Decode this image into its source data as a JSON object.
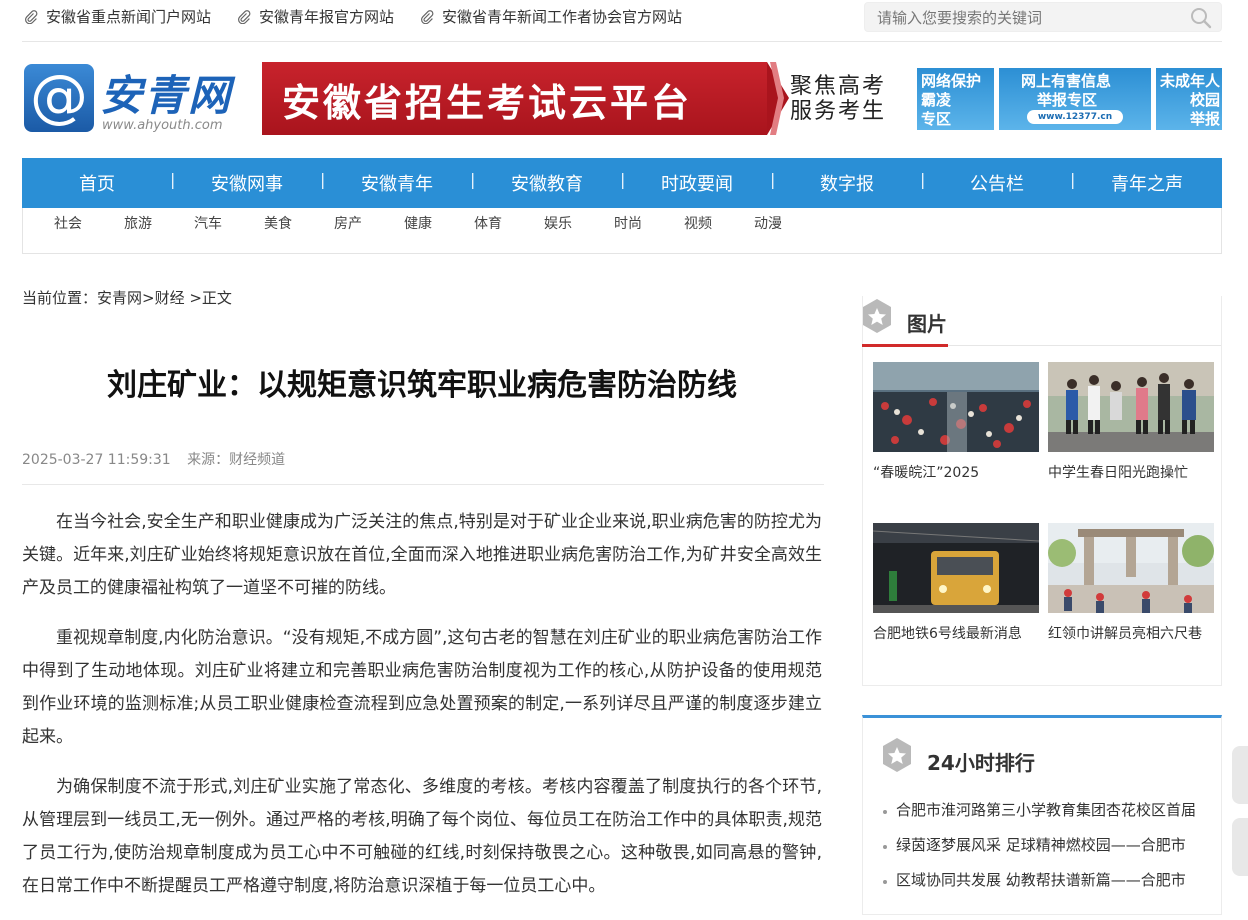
{
  "top_links": [
    {
      "label": "安徽省重点新闻门户网站",
      "icon": "paperclip-icon"
    },
    {
      "label": "安徽青年报官方网站",
      "icon": "paperclip-icon"
    },
    {
      "label": "安徽省青年新闻工作者协会官方网站",
      "icon": "paperclip-icon"
    }
  ],
  "search": {
    "placeholder": "请输入您要搜索的关键词",
    "icon": "search-icon"
  },
  "logo": {
    "symbol": "@",
    "name": "安青网",
    "url": "www.ahyouth.com"
  },
  "banner": {
    "title": "安徽省招生考试云平台",
    "slogan_line1": "聚焦高考",
    "slogan_line2": "服务考生"
  },
  "side_ads": [
    {
      "line1": "网络保护",
      "line2": "霸凌",
      "line3": "专区"
    },
    {
      "line1": "网上有害信息",
      "line2": "举报专区",
      "url": "www.12377.cn"
    },
    {
      "line1": "未成年人",
      "line2": "校园",
      "line3": "举报"
    }
  ],
  "nav": [
    "首页",
    "安徽网事",
    "安徽青年",
    "安徽教育",
    "时政要闻",
    "数字报",
    "公告栏",
    "青年之声"
  ],
  "subnav": [
    "社会",
    "旅游",
    "汽车",
    "美食",
    "房产",
    "健康",
    "体育",
    "娱乐",
    "时尚",
    "视频",
    "动漫"
  ],
  "breadcrumb": "当前位置：安青网>财经 >正文",
  "article": {
    "title": "刘庄矿业：以规矩意识筑牢职业病危害防治防线",
    "datetime": "2025-03-27 11:59:31",
    "source": "来源：财经频道",
    "paragraphs": [
      "在当今社会,安全生产和职业健康成为广泛关注的焦点,特别是对于矿业企业来说,职业病危害的防控尤为关键。近年来,刘庄矿业始终将规矩意识放在首位,全面而深入地推进职业病危害防治工作,为矿井安全高效生产及员工的健康福祉构筑了一道坚不可摧的防线。",
      "重视规章制度,内化防治意识。“没有规矩,不成方圆”,这句古老的智慧在刘庄矿业的职业病危害防治工作中得到了生动地体现。刘庄矿业将建立和完善职业病危害防治制度视为工作的核心,从防护设备的使用规范到作业环境的监测标准;从员工职业健康检查流程到应急处置预案的制定,一系列详尽且严谨的制度逐步建立起来。",
      "为确保制度不流于形式,刘庄矿业实施了常态化、多维度的考核。考核内容覆盖了制度执行的各个环节,从管理层到一线员工,无一例外。通过严格的考核,明确了每个岗位、每位员工在防治工作中的具体职责,规范了员工行为,使防治规章制度成为员工心中不可触碰的红线,时刻保持敬畏之心。这种敬畏,如同高悬的警钟,在日常工作中不断提醒员工严格遵守制度,将防治意识深植于每一位员工心中。"
    ]
  },
  "pictures": {
    "title": "图片",
    "items": [
      {
        "caption": "“春暖皖江”2025",
        "icon": "crowd-photo"
      },
      {
        "caption": "中学生春日阳光跑操忙",
        "icon": "runners-photo"
      },
      {
        "caption": "合肥地铁6号线最新消息",
        "icon": "metro-train-photo"
      },
      {
        "caption": "红领巾讲解员亮相六尺巷",
        "icon": "archway-photo"
      }
    ]
  },
  "ranking": {
    "title": "24小时排行",
    "items": [
      "合肥市淮河路第三小学教育集团杏花校区首届",
      "绿茵逐梦展风采 足球精神燃校园——合肥市",
      "区域协同共发展 幼教帮扶谱新篇——合肥市"
    ]
  },
  "colors": {
    "nav_blue": "#2a8fd6",
    "banner_red": "#c8232c",
    "accent_red": "#d12a2a"
  }
}
